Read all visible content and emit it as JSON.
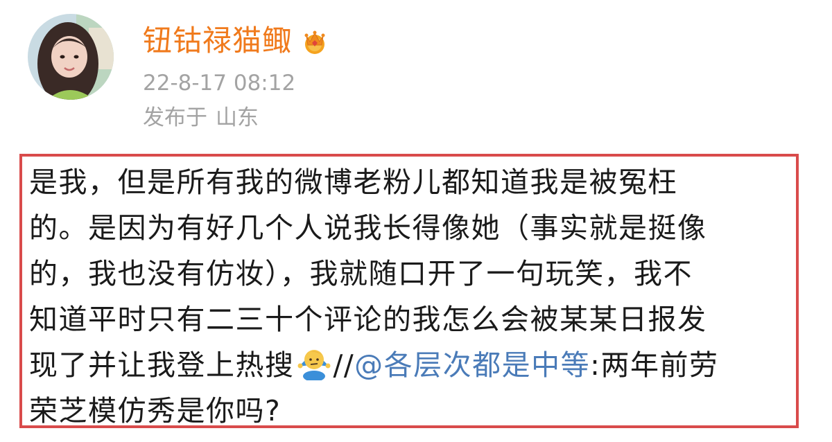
{
  "post": {
    "author": {
      "name": "钮钴禄猫鲰",
      "avatar_icon": "user-avatar",
      "badge_icon": "crown-vip-icon"
    },
    "timestamp": "22-8-17 08:12",
    "location_prefix": "发布于",
    "location": "山东",
    "content": {
      "lines": [
        "是我，但是所有我的微博老粉儿都知道我是被冤枉",
        "的。是因为有好几个人说我长得像她（事实就是挺像",
        "的，我也没有仿妆），我就随口开了一句玩笑，我不",
        "知道平时只有二三十个评论的我怎么会被某某日报发"
      ],
      "line5_text": "现了并让我登上热搜",
      "emoji_icon": "shrug-emoji-icon",
      "repost_separator": "//",
      "mention": "@各层次都是中等",
      "after_mention": ":两年前劳",
      "last_line": "荣芝模仿秀是你吗?"
    },
    "colors": {
      "username": "#f07a1c",
      "meta": "#a3a3a3",
      "mention": "#4a7bb8",
      "highlight_border": "#d94b4b",
      "text": "#1a1a1a"
    }
  }
}
